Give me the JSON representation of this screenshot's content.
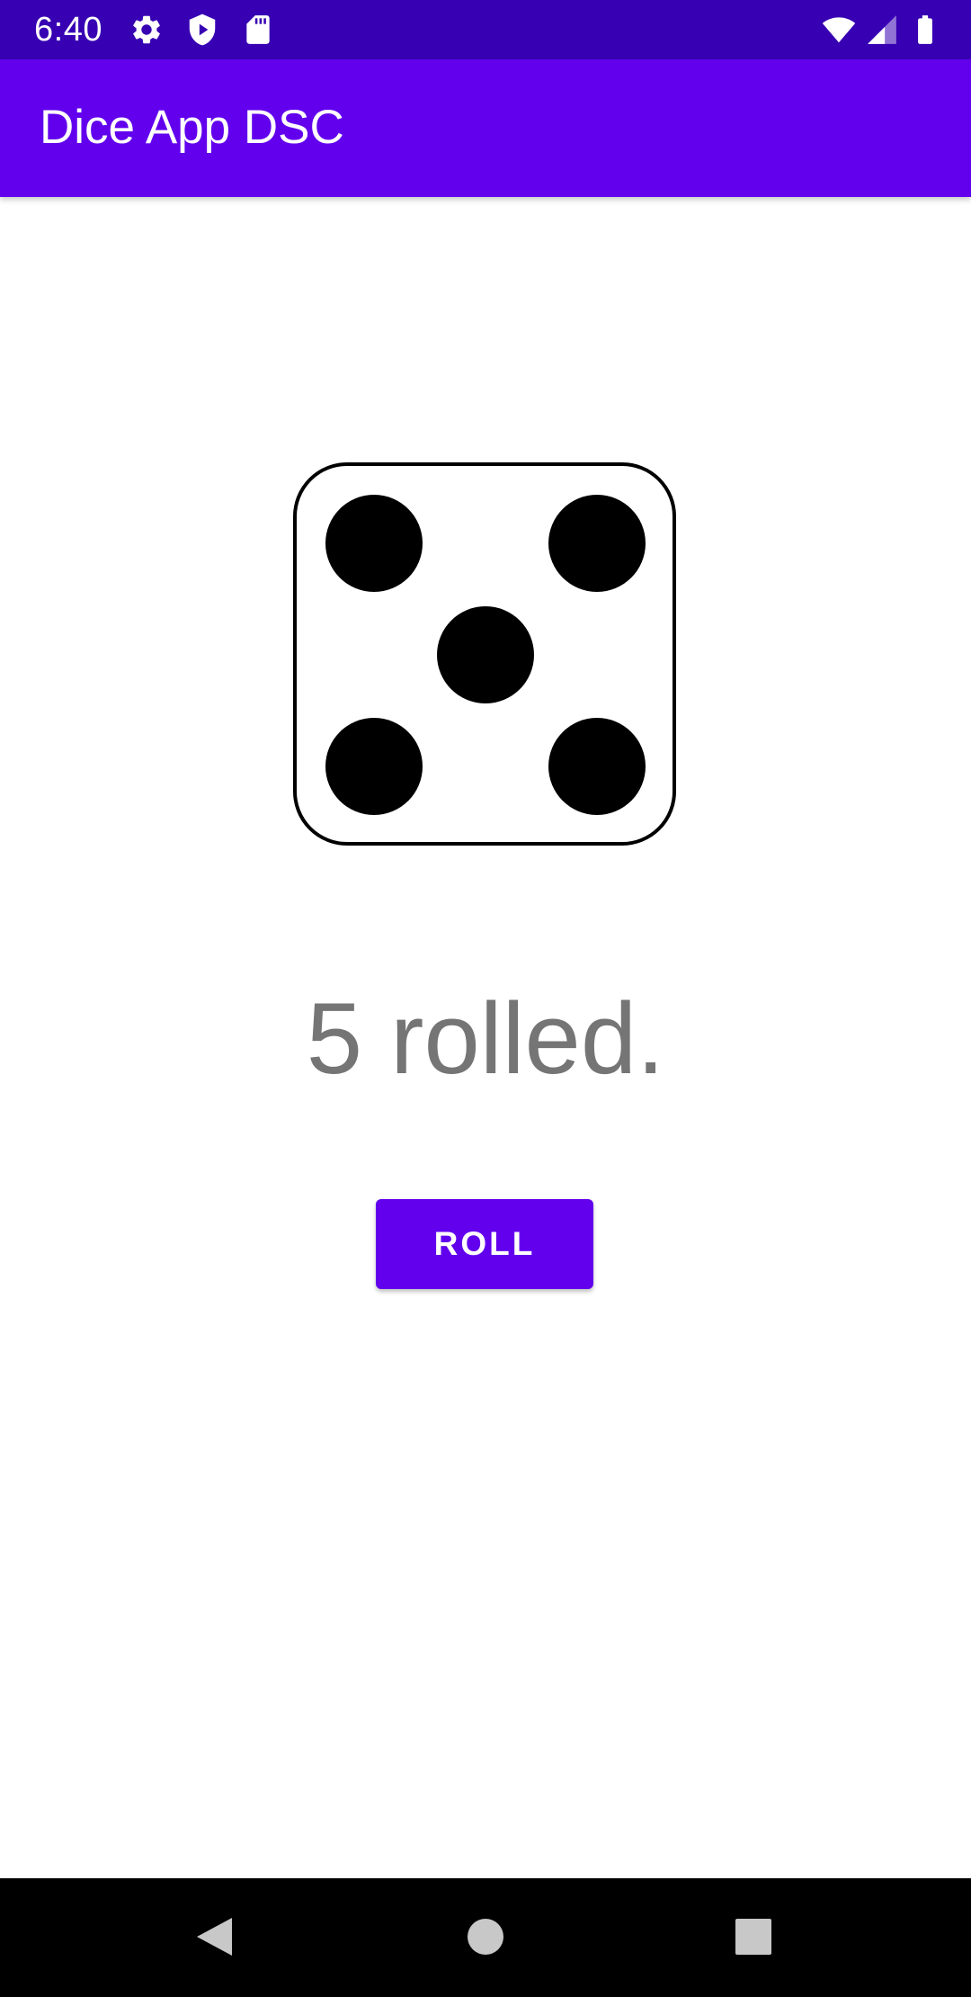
{
  "status_bar": {
    "time": "6:40",
    "left_icons": [
      "settings-icon",
      "play-protect-icon",
      "sd-card-icon"
    ],
    "right_icons": [
      "wifi-icon",
      "cell-signal-icon",
      "battery-icon"
    ]
  },
  "app_bar": {
    "title": "Dice App DSC"
  },
  "main": {
    "dice_value": 5,
    "result_text": "5 rolled.",
    "roll_button_label": "ROLL"
  },
  "nav_bar": {
    "buttons": [
      "back-icon",
      "home-icon",
      "recents-icon"
    ]
  },
  "colors": {
    "status_bar": "#3700B3",
    "primary": "#6200EE",
    "result_text": "#757575",
    "background": "#FFFFFF",
    "nav_bar": "#000000"
  }
}
